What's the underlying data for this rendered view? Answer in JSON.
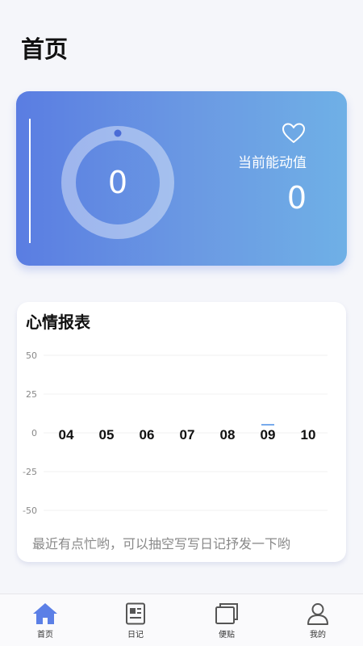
{
  "header": {
    "title": "首页"
  },
  "energy_card": {
    "ring_value": "0",
    "label": "当前能动值",
    "value": "0"
  },
  "mood_report": {
    "title": "心情报表",
    "empty_message": "最近有点忙哟，可以抽空写写日记抒发一下哟",
    "chart_data": {
      "type": "line",
      "title": "心情报表",
      "categories": [
        "04",
        "05",
        "06",
        "07",
        "08",
        "09",
        "10"
      ],
      "series": [
        {
          "values": [
            0,
            0,
            0,
            0,
            0,
            0,
            0
          ]
        }
      ],
      "ylim": [
        -50,
        50
      ],
      "yticks": [
        "50",
        "25",
        "0",
        "-25",
        "-50"
      ],
      "grid": true,
      "highlight_color": "#4a8fe6"
    }
  },
  "tabbar": {
    "items": [
      {
        "label": "首页",
        "icon": "home-icon",
        "active": true
      },
      {
        "label": "日记",
        "icon": "diary-icon",
        "active": false
      },
      {
        "label": "便贴",
        "icon": "notes-icon",
        "active": false
      },
      {
        "label": "我的",
        "icon": "profile-icon",
        "active": false
      }
    ],
    "active_color": "#5b7fe6"
  }
}
